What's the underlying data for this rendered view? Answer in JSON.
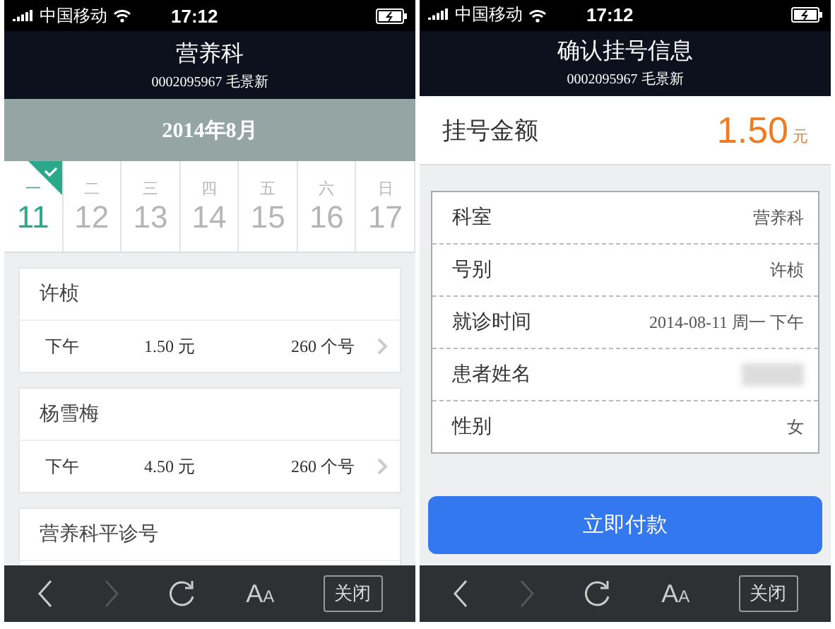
{
  "screens": [
    {
      "status_bar": {
        "carrier": "中国移动",
        "time": "17:12"
      },
      "header": {
        "title": "营养科",
        "subtitle": "0002095967 毛景新"
      },
      "month": "2014年8月",
      "days": [
        {
          "weekday": "一",
          "date": "11",
          "selected": true
        },
        {
          "weekday": "二",
          "date": "12",
          "selected": false
        },
        {
          "weekday": "三",
          "date": "13",
          "selected": false
        },
        {
          "weekday": "四",
          "date": "14",
          "selected": false
        },
        {
          "weekday": "五",
          "date": "15",
          "selected": false
        },
        {
          "weekday": "六",
          "date": "16",
          "selected": false
        },
        {
          "weekday": "日",
          "date": "17",
          "selected": false
        }
      ],
      "doctors": [
        {
          "name": "许桢",
          "period": "下午",
          "fee": "1.50 元",
          "count": "260 个号"
        },
        {
          "name": "杨雪梅",
          "period": "下午",
          "fee": "4.50 元",
          "count": "260 个号"
        },
        {
          "name": "营养科平诊号"
        }
      ],
      "toolbar": {
        "font_button": "A$_{A}$",
        "close": "关闭"
      }
    },
    {
      "status_bar": {
        "carrier": "中国移动",
        "time": "17:12"
      },
      "header": {
        "title": "确认挂号信息",
        "subtitle": "0002095967 毛景新"
      },
      "amount": {
        "label": "挂号金额",
        "value": "1.50",
        "unit": "元"
      },
      "info": [
        {
          "label": "科室",
          "value": "营养科"
        },
        {
          "label": "号别",
          "value": "许桢"
        },
        {
          "label": "就诊时间",
          "value": "2014-08-11 周一 下午"
        },
        {
          "label": "患者姓名",
          "redacted": true
        },
        {
          "label": "性别",
          "value": "女"
        }
      ],
      "pay_button": "立即付款",
      "toolbar": {
        "font_button": "A$_{A}$",
        "close": "关闭"
      }
    }
  ]
}
